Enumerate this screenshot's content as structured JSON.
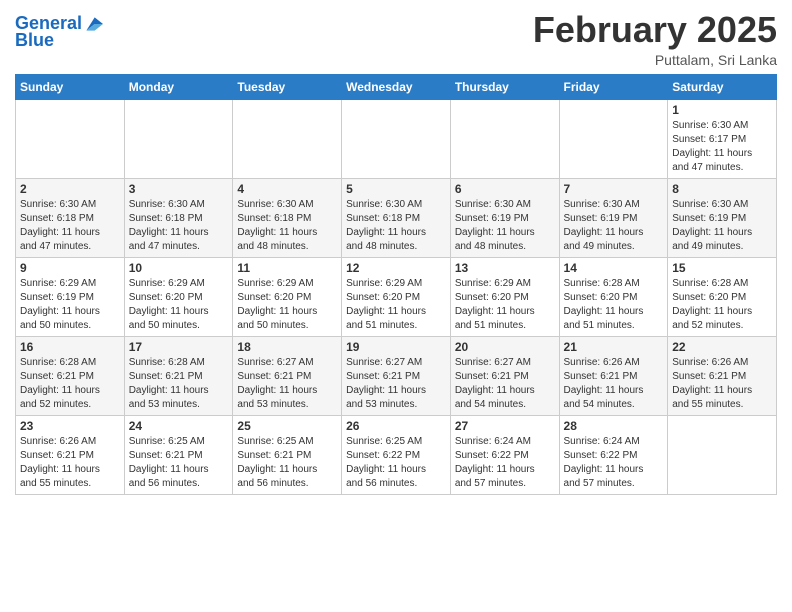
{
  "header": {
    "logo_line1": "General",
    "logo_line2": "Blue",
    "month": "February 2025",
    "location": "Puttalam, Sri Lanka"
  },
  "weekdays": [
    "Sunday",
    "Monday",
    "Tuesday",
    "Wednesday",
    "Thursday",
    "Friday",
    "Saturday"
  ],
  "weeks": [
    [
      {
        "day": "",
        "info": ""
      },
      {
        "day": "",
        "info": ""
      },
      {
        "day": "",
        "info": ""
      },
      {
        "day": "",
        "info": ""
      },
      {
        "day": "",
        "info": ""
      },
      {
        "day": "",
        "info": ""
      },
      {
        "day": "1",
        "info": "Sunrise: 6:30 AM\nSunset: 6:17 PM\nDaylight: 11 hours\nand 47 minutes."
      }
    ],
    [
      {
        "day": "2",
        "info": "Sunrise: 6:30 AM\nSunset: 6:18 PM\nDaylight: 11 hours\nand 47 minutes."
      },
      {
        "day": "3",
        "info": "Sunrise: 6:30 AM\nSunset: 6:18 PM\nDaylight: 11 hours\nand 47 minutes."
      },
      {
        "day": "4",
        "info": "Sunrise: 6:30 AM\nSunset: 6:18 PM\nDaylight: 11 hours\nand 48 minutes."
      },
      {
        "day": "5",
        "info": "Sunrise: 6:30 AM\nSunset: 6:18 PM\nDaylight: 11 hours\nand 48 minutes."
      },
      {
        "day": "6",
        "info": "Sunrise: 6:30 AM\nSunset: 6:19 PM\nDaylight: 11 hours\nand 48 minutes."
      },
      {
        "day": "7",
        "info": "Sunrise: 6:30 AM\nSunset: 6:19 PM\nDaylight: 11 hours\nand 49 minutes."
      },
      {
        "day": "8",
        "info": "Sunrise: 6:30 AM\nSunset: 6:19 PM\nDaylight: 11 hours\nand 49 minutes."
      }
    ],
    [
      {
        "day": "9",
        "info": "Sunrise: 6:29 AM\nSunset: 6:19 PM\nDaylight: 11 hours\nand 50 minutes."
      },
      {
        "day": "10",
        "info": "Sunrise: 6:29 AM\nSunset: 6:20 PM\nDaylight: 11 hours\nand 50 minutes."
      },
      {
        "day": "11",
        "info": "Sunrise: 6:29 AM\nSunset: 6:20 PM\nDaylight: 11 hours\nand 50 minutes."
      },
      {
        "day": "12",
        "info": "Sunrise: 6:29 AM\nSunset: 6:20 PM\nDaylight: 11 hours\nand 51 minutes."
      },
      {
        "day": "13",
        "info": "Sunrise: 6:29 AM\nSunset: 6:20 PM\nDaylight: 11 hours\nand 51 minutes."
      },
      {
        "day": "14",
        "info": "Sunrise: 6:28 AM\nSunset: 6:20 PM\nDaylight: 11 hours\nand 51 minutes."
      },
      {
        "day": "15",
        "info": "Sunrise: 6:28 AM\nSunset: 6:20 PM\nDaylight: 11 hours\nand 52 minutes."
      }
    ],
    [
      {
        "day": "16",
        "info": "Sunrise: 6:28 AM\nSunset: 6:21 PM\nDaylight: 11 hours\nand 52 minutes."
      },
      {
        "day": "17",
        "info": "Sunrise: 6:28 AM\nSunset: 6:21 PM\nDaylight: 11 hours\nand 53 minutes."
      },
      {
        "day": "18",
        "info": "Sunrise: 6:27 AM\nSunset: 6:21 PM\nDaylight: 11 hours\nand 53 minutes."
      },
      {
        "day": "19",
        "info": "Sunrise: 6:27 AM\nSunset: 6:21 PM\nDaylight: 11 hours\nand 53 minutes."
      },
      {
        "day": "20",
        "info": "Sunrise: 6:27 AM\nSunset: 6:21 PM\nDaylight: 11 hours\nand 54 minutes."
      },
      {
        "day": "21",
        "info": "Sunrise: 6:26 AM\nSunset: 6:21 PM\nDaylight: 11 hours\nand 54 minutes."
      },
      {
        "day": "22",
        "info": "Sunrise: 6:26 AM\nSunset: 6:21 PM\nDaylight: 11 hours\nand 55 minutes."
      }
    ],
    [
      {
        "day": "23",
        "info": "Sunrise: 6:26 AM\nSunset: 6:21 PM\nDaylight: 11 hours\nand 55 minutes."
      },
      {
        "day": "24",
        "info": "Sunrise: 6:25 AM\nSunset: 6:21 PM\nDaylight: 11 hours\nand 56 minutes."
      },
      {
        "day": "25",
        "info": "Sunrise: 6:25 AM\nSunset: 6:21 PM\nDaylight: 11 hours\nand 56 minutes."
      },
      {
        "day": "26",
        "info": "Sunrise: 6:25 AM\nSunset: 6:22 PM\nDaylight: 11 hours\nand 56 minutes."
      },
      {
        "day": "27",
        "info": "Sunrise: 6:24 AM\nSunset: 6:22 PM\nDaylight: 11 hours\nand 57 minutes."
      },
      {
        "day": "28",
        "info": "Sunrise: 6:24 AM\nSunset: 6:22 PM\nDaylight: 11 hours\nand 57 minutes."
      },
      {
        "day": "",
        "info": ""
      }
    ]
  ]
}
